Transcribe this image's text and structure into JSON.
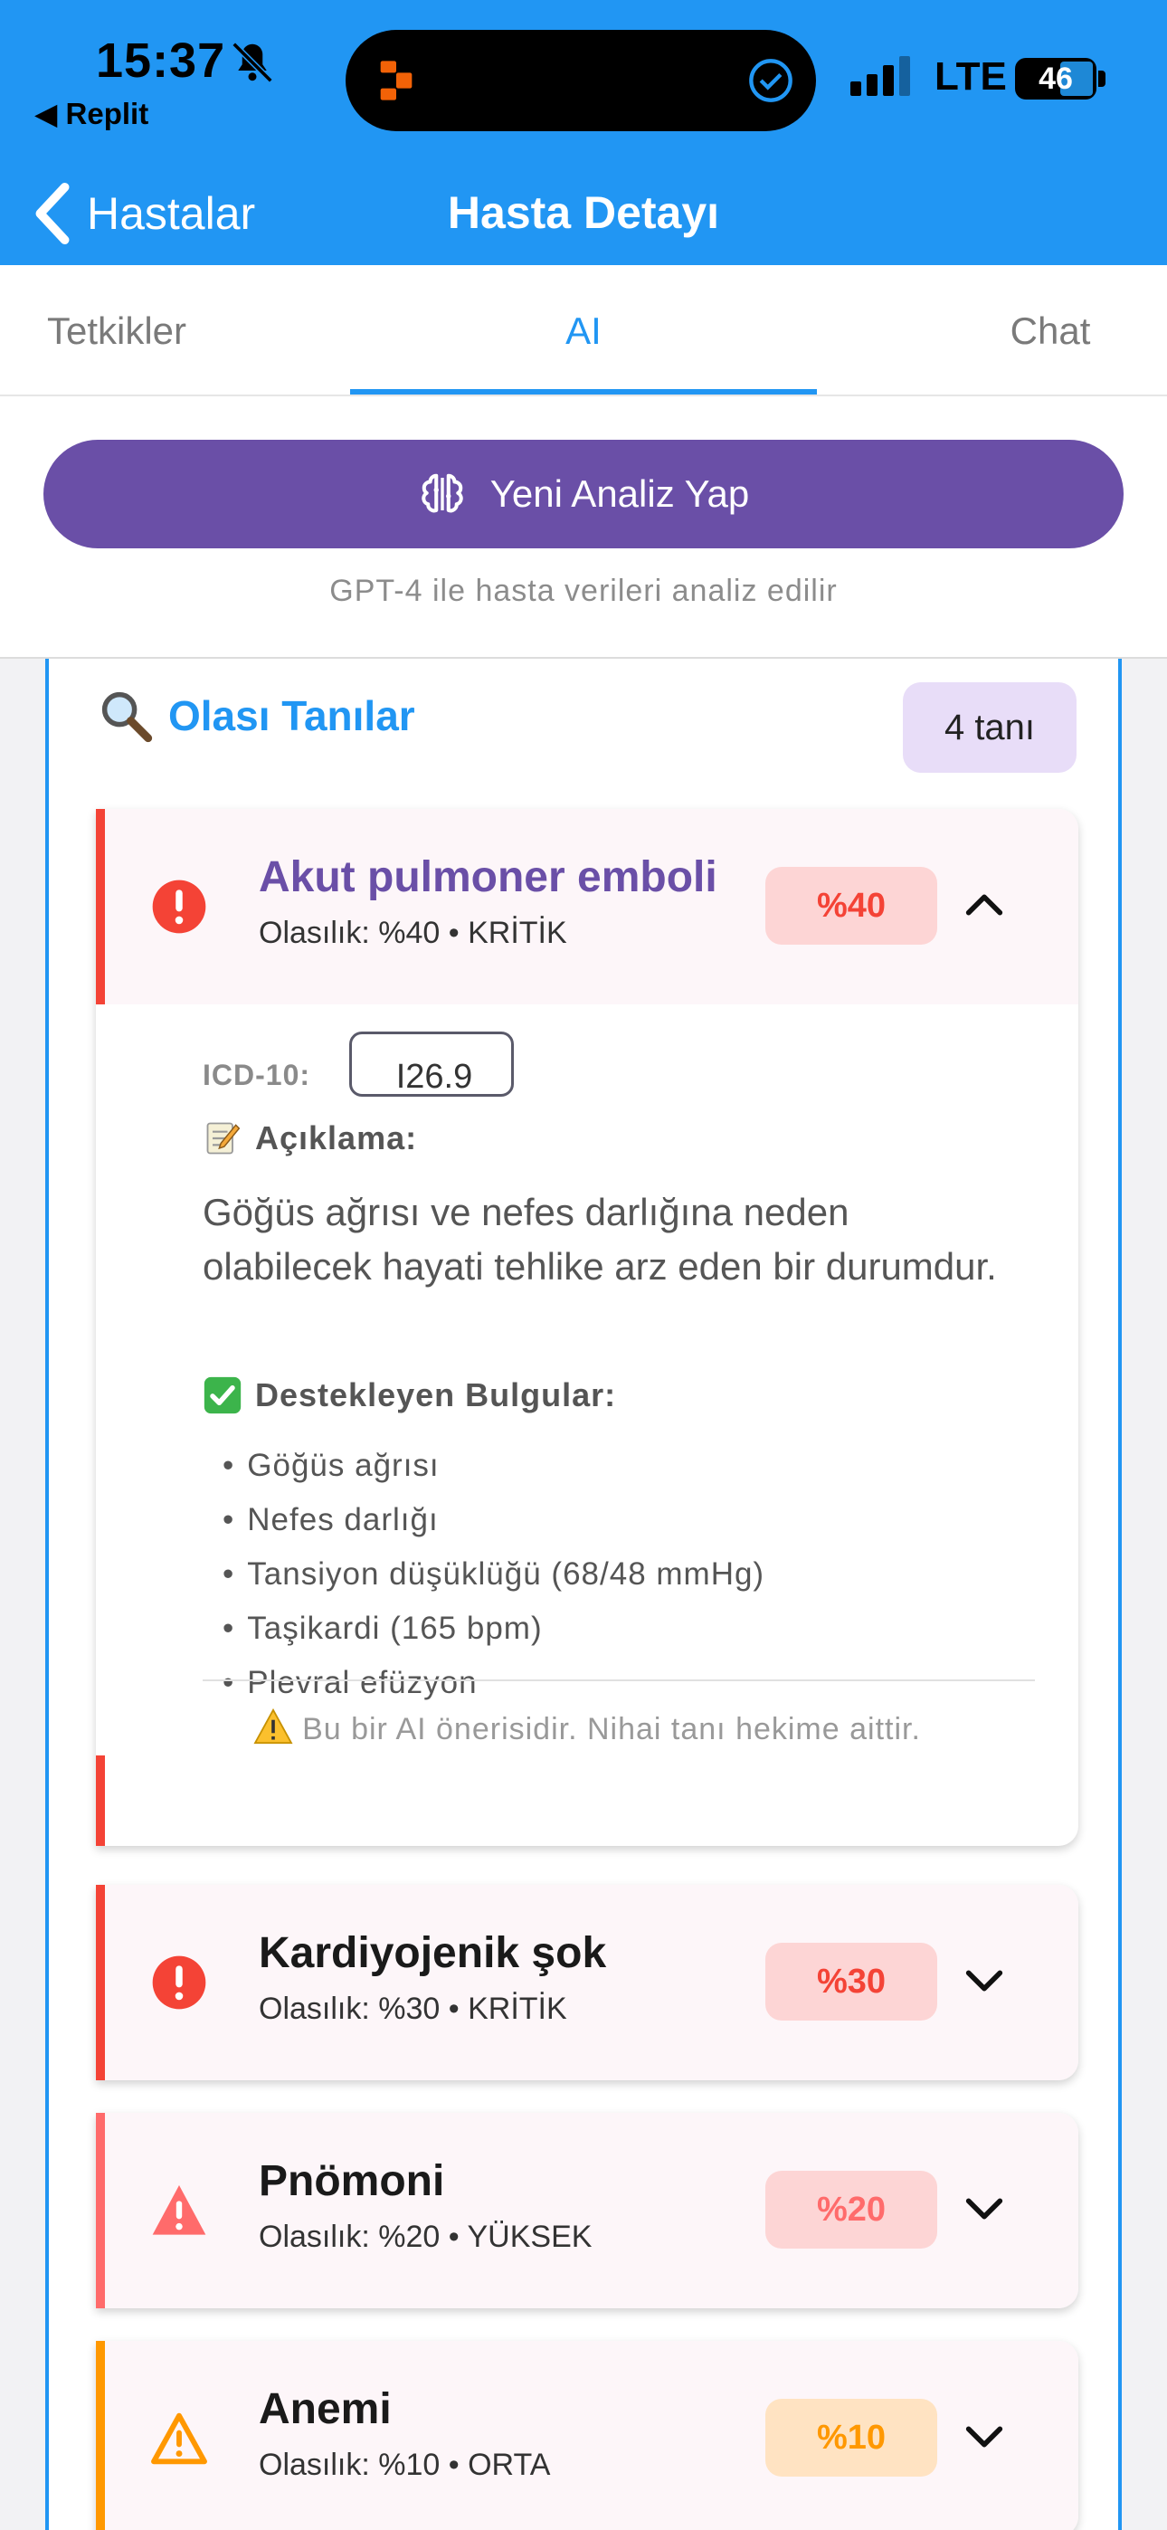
{
  "status_bar": {
    "time": "15:37",
    "back_app": "◀ Replit",
    "network": "LTE",
    "battery": "46"
  },
  "nav": {
    "back_label": "Hastalar",
    "title": "Hasta Detayı"
  },
  "tabs": [
    {
      "label": "Tetkikler",
      "active": false
    },
    {
      "label": "AI",
      "active": true
    },
    {
      "label": "Chat",
      "active": false
    }
  ],
  "analyze": {
    "button_label": "Yeni Analiz Yap",
    "hint": "GPT-4 ile hasta verileri analiz edilir"
  },
  "diagnoses": {
    "title": "Olası Tanılar",
    "count_label": "4 tanı",
    "items": [
      {
        "name": "Akut pulmoner emboli",
        "subtitle": "Olasılık: %40 • KRİTİK",
        "percent_label": "%40",
        "severity": "KRİTİK",
        "color": "#f44336",
        "expanded": true,
        "icd_label": "ICD-10:",
        "icd_code": "I26.9",
        "description_title": "Açıklama:",
        "description": "Göğüs ağrısı ve nefes darlığına neden olabilecek hayati tehlike arz eden bir durumdur.",
        "findings_title": "Destekleyen Bulgular:",
        "findings": [
          "Göğüs ağrısı",
          "Nefes darlığı",
          "Tansiyon düşüklüğü (68/48 mmHg)",
          "Taşikardi (165 bpm)",
          "Plevral efüzyon"
        ],
        "disclaimer": "Bu bir AI önerisidir. Nihai tanı hekime aittir."
      },
      {
        "name": "Kardiyojenik şok",
        "subtitle": "Olasılık: %30 • KRİTİK",
        "percent_label": "%30",
        "severity": "KRİTİK",
        "color": "#f44336",
        "expanded": false
      },
      {
        "name": "Pnömoni",
        "subtitle": "Olasılık: %20 • YÜKSEK",
        "percent_label": "%20",
        "severity": "YÜKSEK",
        "color": "#ff6b6b",
        "expanded": false
      },
      {
        "name": "Anemi",
        "subtitle": "Olasılık: %10 • ORTA",
        "percent_label": "%10",
        "severity": "ORTA",
        "color": "#ff9800",
        "expanded": false
      }
    ]
  },
  "colors": {
    "primary": "#2196f3",
    "purple": "#6a4fa7",
    "critical": "#f44336",
    "high": "#ff6b6b",
    "medium": "#ff9800"
  }
}
